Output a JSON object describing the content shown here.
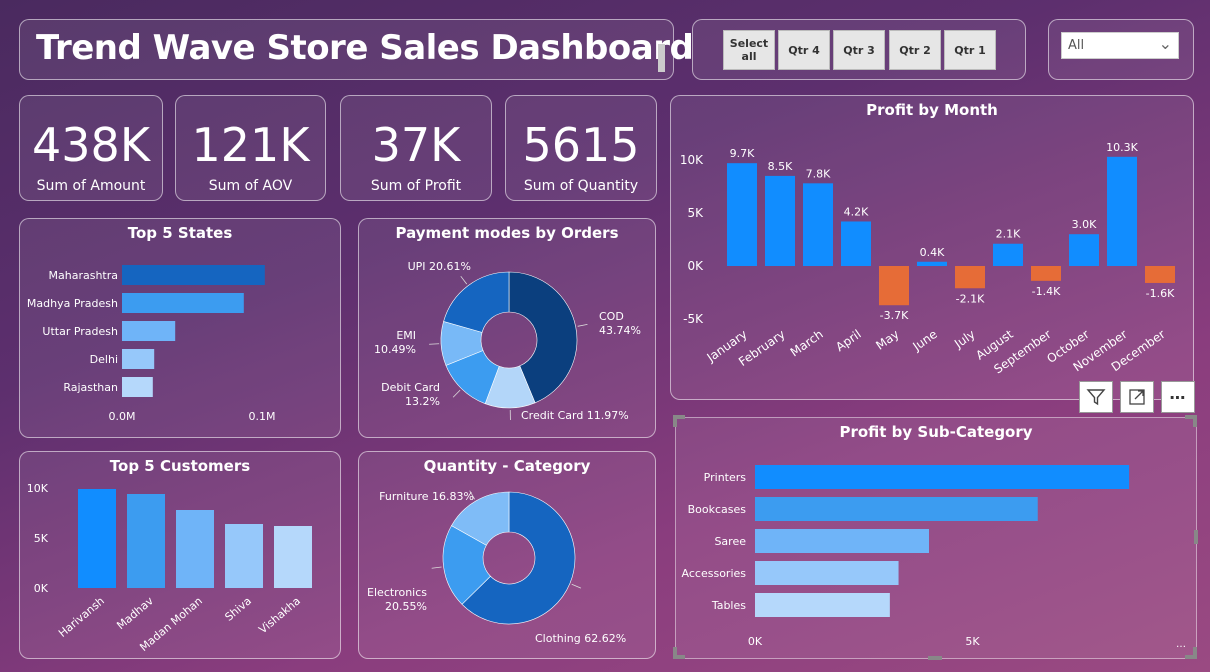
{
  "title": "Trend Wave Store Sales Dashboard",
  "kpis": [
    {
      "value": "438K",
      "label": "Sum of Amount"
    },
    {
      "value": "121K",
      "label": "Sum of AOV"
    },
    {
      "value": "37K",
      "label": "Sum of Profit"
    },
    {
      "value": "5615",
      "label": "Sum of Quantity"
    }
  ],
  "quarter_slicer": {
    "buttons": [
      "Select all",
      "Qtr 4",
      "Qtr 3",
      "Qtr 2",
      "Qtr 1"
    ]
  },
  "dropdown": {
    "value": "All"
  },
  "visual_header": {
    "filter_icon": "filter-icon",
    "focus_icon": "focus-mode-icon",
    "more_icon": "more-options-icon"
  },
  "colors": {
    "blue": "#118dff",
    "orange": "#e66c37",
    "dark_blue": "#12239e"
  },
  "chart_data": [
    {
      "id": "top_states",
      "type": "bar",
      "orientation": "horizontal",
      "title": "Top 5 States",
      "categories": [
        "Maharashtra",
        "Madhya Pradesh",
        "Uttar Pradesh",
        "Delhi",
        "Rajasthan"
      ],
      "values": [
        0.102,
        0.087,
        0.038,
        0.023,
        0.022
      ],
      "colors": [
        "#1565c0",
        "#3c9cf0",
        "#6fb4f8",
        "#96c8fa",
        "#b5d8fb"
      ],
      "xticks": [
        "0.0M",
        "0.1M"
      ],
      "xlim": [
        0,
        0.1
      ]
    },
    {
      "id": "payment_modes",
      "type": "pie",
      "donut": true,
      "title": "Payment modes by Orders",
      "categories": [
        "COD",
        "Credit Card",
        "Debit Card",
        "EMI",
        "UPI"
      ],
      "values": [
        43.74,
        11.97,
        13.2,
        10.49,
        20.61
      ],
      "labels": [
        "COD\n43.74%",
        "Credit Card 11.97%",
        "Debit Card\n13.2%",
        "EMI\n10.49%",
        "UPI 20.61%"
      ],
      "colors": [
        "#0b3f7e",
        "#b3d6f9",
        "#3c9cf0",
        "#78b9f7",
        "#1565c0"
      ]
    },
    {
      "id": "profit_by_month",
      "type": "bar",
      "title": "Profit by Month",
      "categories": [
        "January",
        "February",
        "March",
        "April",
        "May",
        "June",
        "July",
        "August",
        "September",
        "October",
        "November",
        "December"
      ],
      "values": [
        9.7,
        8.5,
        7.8,
        4.2,
        -3.7,
        0.4,
        -2.1,
        2.1,
        -1.4,
        3.0,
        10.3,
        -1.6
      ],
      "data_labels": [
        "9.7K",
        "8.5K",
        "7.8K",
        "4.2K",
        "-3.7K",
        "0.4K",
        "-2.1K",
        "2.1K",
        "-1.4K",
        "3.0K",
        "10.3K",
        "-1.6K"
      ],
      "yticks": [
        "10K",
        "5K",
        "0K",
        "-5K"
      ],
      "ylim": [
        -5,
        10
      ],
      "positive_color": "#118dff",
      "negative_color": "#e66c37"
    },
    {
      "id": "top_customers",
      "type": "bar",
      "title": "Top 5 Customers",
      "categories": [
        "Harivansh",
        "Madhav",
        "Madan Mohan",
        "Shiva",
        "Vishakha"
      ],
      "values": [
        9.9,
        9.4,
        7.8,
        6.4,
        6.2
      ],
      "colors": [
        "#118dff",
        "#3c9cf0",
        "#6fb4f8",
        "#96c8fa",
        "#b5d8fb"
      ],
      "yticks": [
        "10K",
        "5K",
        "0K"
      ],
      "ylim": [
        0,
        10
      ]
    },
    {
      "id": "quantity_category",
      "type": "pie",
      "donut": true,
      "title": "Quantity - Category",
      "categories": [
        "Clothing",
        "Electronics",
        "Furniture"
      ],
      "values": [
        62.62,
        20.55,
        16.83
      ],
      "labels": [
        "Clothing 62.62%",
        "Electronics\n20.55%",
        "Furniture 16.83%"
      ],
      "colors": [
        "#1565c0",
        "#3c9cf0",
        "#7fbcf7"
      ]
    },
    {
      "id": "profit_by_subcategory",
      "type": "bar",
      "orientation": "horizontal",
      "title": "Profit by Sub-Category",
      "categories": [
        "Printers",
        "Bookcases",
        "Saree",
        "Accessories",
        "Tables"
      ],
      "values": [
        8.6,
        6.5,
        4.0,
        3.3,
        3.1
      ],
      "colors": [
        "#118dff",
        "#3c9cf0",
        "#6fb4f8",
        "#96c8fa",
        "#b5d8fb"
      ],
      "xticks": [
        "0K",
        "5K"
      ],
      "xlim": [
        0,
        5
      ]
    }
  ]
}
